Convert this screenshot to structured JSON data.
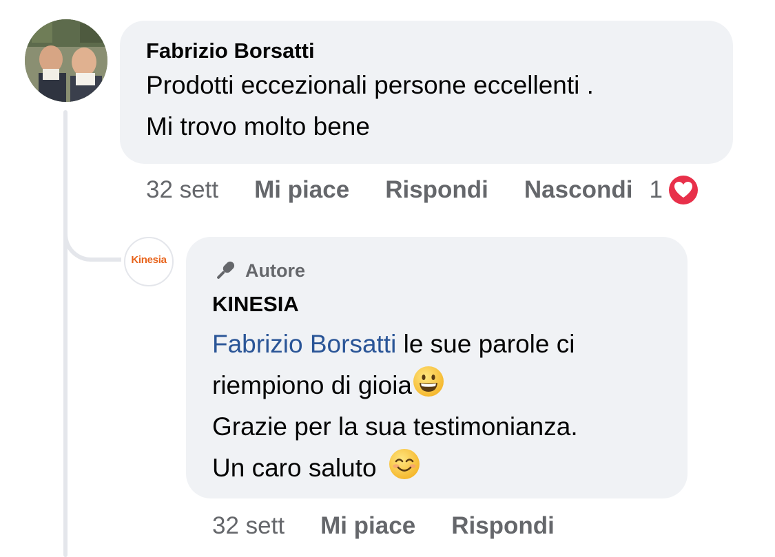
{
  "comment": {
    "author": "Fabrizio Borsatti",
    "lines": [
      "Prodotti eccezionali persone eccellenti .",
      "Mi trovo molto bene"
    ],
    "actions": {
      "time": "32 sett",
      "like": "Mi piace",
      "reply": "Rispondi",
      "hide": "Nascondi"
    },
    "reaction_count": "1",
    "reaction_icon": "heart-icon",
    "avatar_icon": "profile-photo"
  },
  "reply": {
    "badge": "Autore",
    "badge_icon": "microphone-icon",
    "author": "KINESIA",
    "mention": "Fabrizio Borsatti",
    "line1_rest": " le sue parole ci",
    "line2": "riempiono di gioia",
    "line2_emoji": "grinning-face-emoji",
    "line3": "Grazie per la sua testimonianza.",
    "line4": "Un caro saluto ",
    "line4_emoji": "smiling-face-emoji",
    "avatar_logo": "Kinesia",
    "actions": {
      "time": "32 sett",
      "like": "Mi piace",
      "reply": "Rispondi"
    }
  },
  "colors": {
    "bubble": "#f0f2f5",
    "text": "#050505",
    "secondary": "#65676b",
    "mention": "#2a5597",
    "heart": "#e8304a",
    "logo": "#e8641c"
  }
}
